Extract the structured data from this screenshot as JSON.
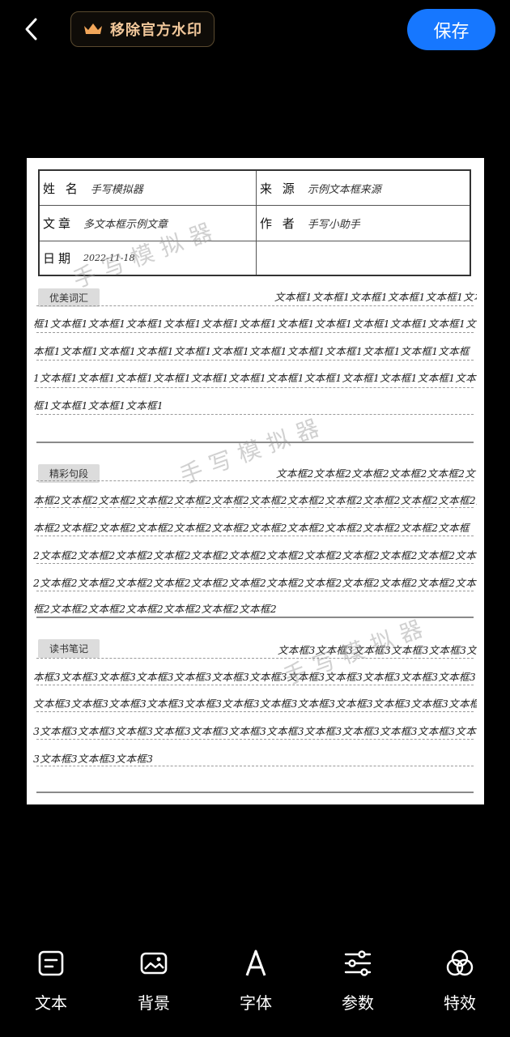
{
  "header": {
    "watermark_label": "移除官方水印",
    "save_label": "保存"
  },
  "paper": {
    "info": {
      "name_label": "姓 名",
      "name_value": "手写模拟器",
      "source_label": "来 源",
      "source_value": "示例文本框来源",
      "article_label": "文章",
      "article_value": "多文本框示例文章",
      "author_label": "作 者",
      "author_value": "手写小助手",
      "date_label": "日期",
      "date_value": "2022-11-18"
    },
    "sections": [
      {
        "tag": "优美词汇",
        "lines": [
          "文本框1文本框1文本框1文本框1文本框1文本",
          "框1文本框1文本框1文本框1文本框1文本框1文本框1文本框1文本框1文本框1文本框1文本框1文",
          "本框1文本框1文本框1文本框1文本框1文本框1文本框1文本框1文本框1文本框1文本框1文本框",
          "1文本框1文本框1文本框1文本框1文本框1文本框1文本框1文本框1文本框1文本框1文本框1文本",
          "框1文本框1文本框1文本框1"
        ]
      },
      {
        "tag": "精彩句段",
        "lines": [
          "文本框2文本框2文本框2文本框2文本框2文",
          "本框2文本框2文本框2文本框2文本框2文本框2文本框2文本框2文本框2文本框2文本框2文本框2文",
          "本框2文本框2文本框2文本框2文本框2文本框2文本框2文本框2文本框2文本框2文本框2文本框",
          "2文本框2文本框2文本框2文本框2文本框2文本框2文本框2文本框2文本框2文本框2文本框2文本框",
          "2文本框2文本框2文本框2文本框2文本框2文本框2文本框2文本框2文本框2文本框2文本框2文本",
          "框2文本框2文本框2文本框2文本框2文本框2文本框2"
        ]
      },
      {
        "tag": "读书笔记",
        "lines": [
          "文本框3文本框3文本框3文本框3文本框3文",
          "本框3文本框3文本框3文本框3文本框3文本框3文本框3文本框3文本框3文本框3文本框3文本框3",
          "文本框3文本框3文本框3文本框3文本框3文本框3文本框3文本框3文本框3文本框3文本框3文本框",
          "3文本框3文本框3文本框3文本框3文本框3文本框3文本框3文本框3文本框3文本框3文本框3文本框",
          "3文本框3文本框3文本框3"
        ]
      }
    ],
    "watermark_text": "手写模拟器"
  },
  "toolbar": [
    {
      "label": "文本",
      "icon": "text-box-icon"
    },
    {
      "label": "背景",
      "icon": "image-icon"
    },
    {
      "label": "字体",
      "icon": "font-a-icon"
    },
    {
      "label": "参数",
      "icon": "sliders-icon"
    },
    {
      "label": "特效",
      "icon": "effects-circles-icon"
    }
  ]
}
